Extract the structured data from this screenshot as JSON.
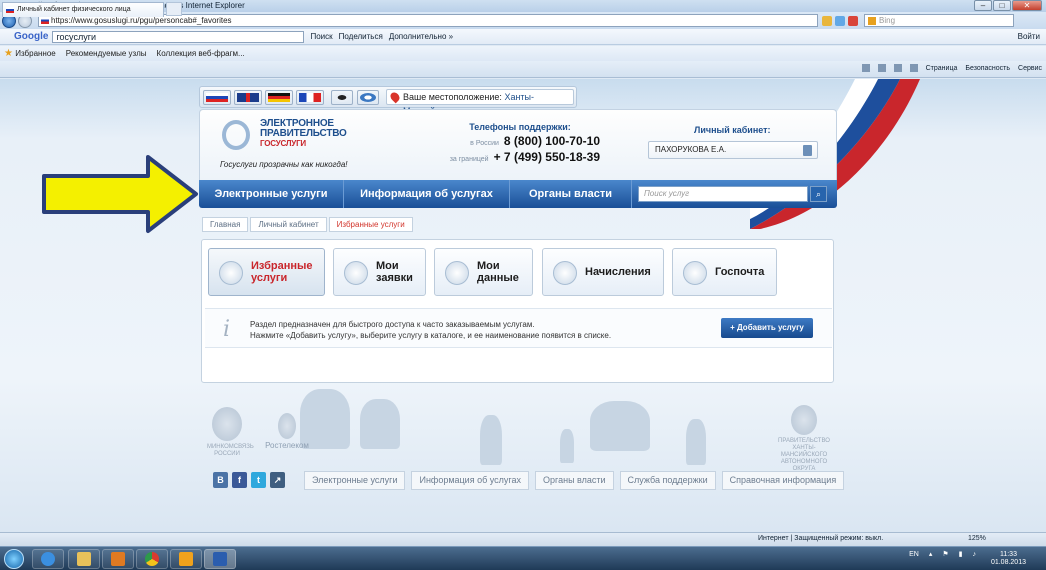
{
  "window": {
    "title": "Личный кабинет физического лица - Windows Internet Explorer",
    "url": "https://www.gosuslugi.ru/pgu/personcab#_favorites",
    "bing_placeholder": "Bing"
  },
  "google_bar": {
    "logo": "Google",
    "query": "госуслуги",
    "search": "Поиск",
    "share": "Поделиться",
    "more": "Дополнительно »",
    "signin": "Войти"
  },
  "favorites_bar": {
    "favorites": "Избранное",
    "recommended": "Рекомендуемые узлы",
    "gallery": "Коллекция веб-фрагм..."
  },
  "tab": {
    "label": "Личный кабинет физического лица"
  },
  "command_bar": {
    "page": "Страница",
    "safety": "Безопасность",
    "tools": "Сервис"
  },
  "location": {
    "label": "Ваше местоположение:",
    "city": "Ханты-Мансийск"
  },
  "header": {
    "logo_line1": "ЭЛЕКТРОННОЕ",
    "logo_line2": "ПРАВИТЕЛЬСТВО",
    "logo_line3": "ГОСУСЛУГИ",
    "slogan": "Госуслуги прозрачны как никогда!",
    "support_title": "Телефоны поддержки:",
    "phones": [
      {
        "label": "в России",
        "number": "8 (800) 100-70-10"
      },
      {
        "label": "за границей",
        "number": "+ 7 (499) 550-18-39"
      }
    ],
    "cabinet_title": "Личный кабинет:",
    "user": "ПАХОРУКОВА Е.А."
  },
  "main_nav": {
    "items": [
      "Электронные услуги",
      "Информация об услугах",
      "Органы власти"
    ],
    "search_placeholder": "Поиск услуг"
  },
  "breadcrumbs": [
    "Главная",
    "Личный кабинет",
    "Избранные услуги"
  ],
  "tiles": [
    {
      "label": "Избранные\nуслуги"
    },
    {
      "label": "Мои\nзаявки"
    },
    {
      "label": "Мои\nданные"
    },
    {
      "label": "Начисления"
    },
    {
      "label": "Госпочта"
    }
  ],
  "info": {
    "line1": "Раздел предназначен для быстрого доступа к часто заказываемым услугам.",
    "line2": "Нажмите «Добавить услугу», выберите услугу в каталоге, и ее наименование появится в списке.",
    "add_button": "+ Добавить услугу"
  },
  "footer": {
    "ministry": "МИНКОМСВЯЗЬ РОССИИ",
    "rostelecom": "Ростелеком",
    "region": "ПРАВИТЕЛЬСТВО ХАНТЫ-МАНСИЙСКОГО АВТОНОМНОГО ОКРУГА",
    "social": [
      "В",
      "f",
      "t",
      "↗"
    ],
    "links": [
      "Электронные услуги",
      "Информация об услугах",
      "Органы власти",
      "Служба поддержки",
      "Справочная информация"
    ]
  },
  "status_bar": {
    "zone": "Интернет | Защищенный режим: выкл.",
    "zoom": "125%"
  },
  "taskbar": {
    "lang": "EN",
    "time": "11:33",
    "date": "01.08.2013"
  },
  "colors": {
    "nav_blue": "#1a4f97",
    "accent_red": "#c9262c",
    "arrow_yellow": "#f4f000"
  }
}
